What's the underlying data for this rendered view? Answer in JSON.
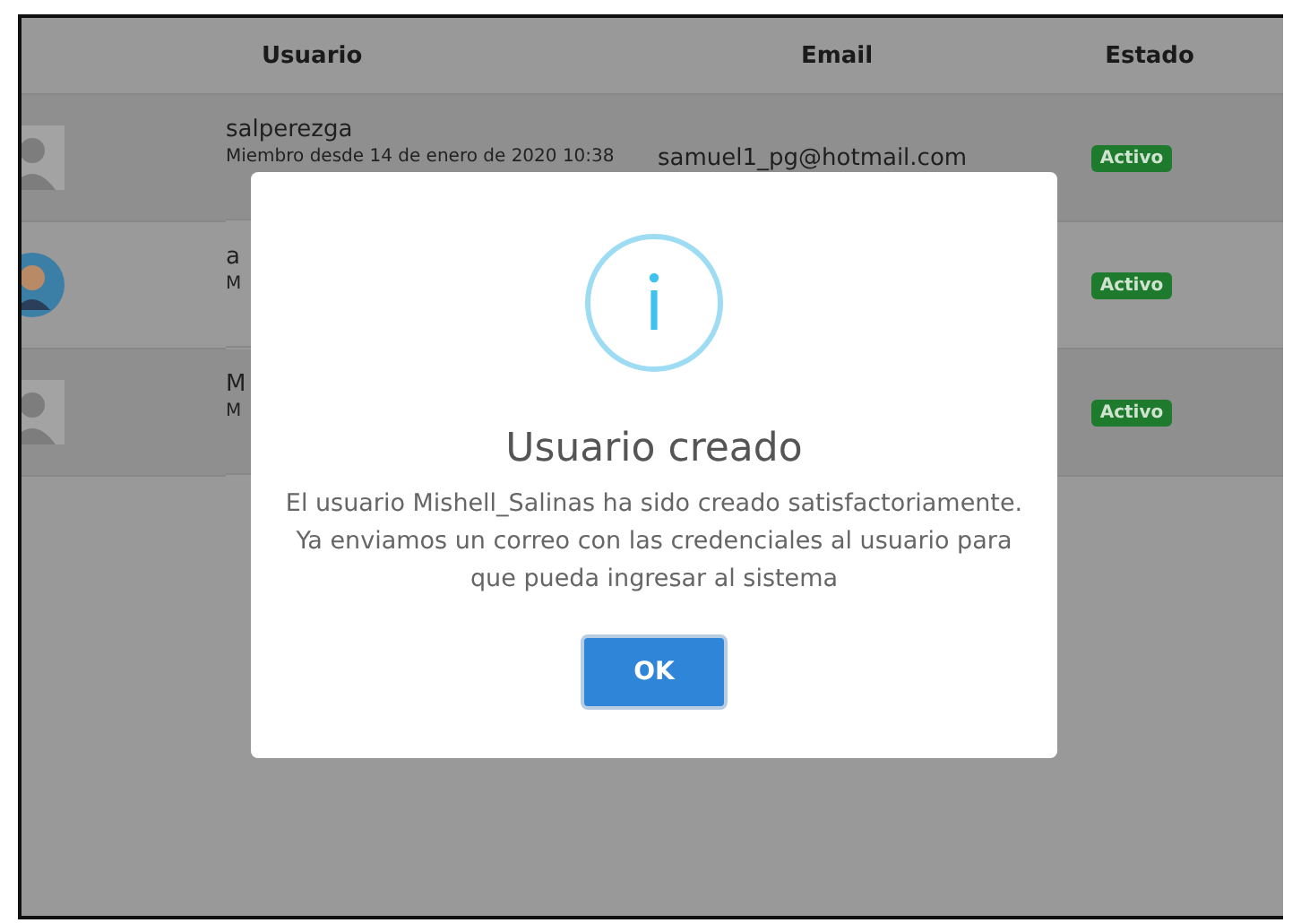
{
  "table": {
    "columns": [
      "Usuario",
      "Email",
      "Estado"
    ],
    "rows": [
      {
        "kind": "placeholder",
        "name": "salperezga",
        "since": "Miembro desde 14 de enero de 2020 10:38",
        "email": "samuel1_pg@hotmail.com",
        "status": "Activo"
      },
      {
        "name": "a",
        "since": "M",
        "status": "Activo"
      },
      {
        "kind": "placeholder",
        "name": "M",
        "since": "M",
        "status": "Activo"
      }
    ]
  },
  "dialog": {
    "title": "Usuario creado",
    "message": "El usuario Mishell_Salinas ha sido creado satisfactoriamente. Ya enviamos un correo con las credenciales al usuario para que pueda ingresar al sistema",
    "button": "OK"
  }
}
